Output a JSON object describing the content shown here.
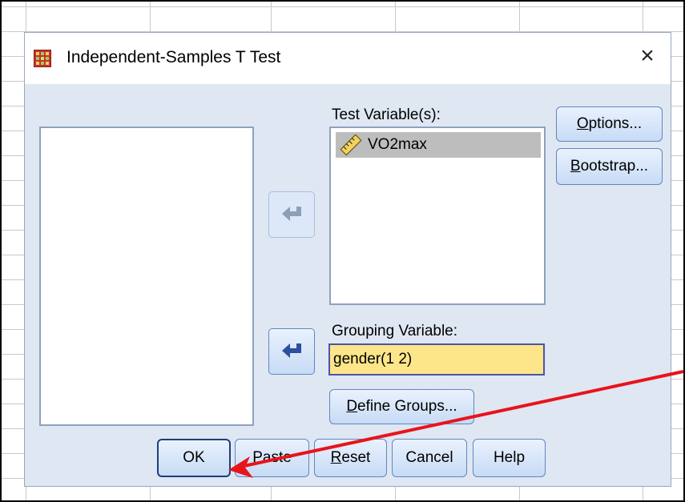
{
  "dialog": {
    "title": "Independent-Samples T Test",
    "close_symbol": "×"
  },
  "test_variables": {
    "label": "Test Variable(s):",
    "items": [
      {
        "name": "VO2max",
        "icon": "scale-ruler-icon"
      }
    ]
  },
  "grouping_variable": {
    "label": "Grouping Variable:",
    "value": "gender(1 2)"
  },
  "buttons": {
    "options": "Options...",
    "bootstrap": "Bootstrap...",
    "define_groups": "Define Groups...",
    "ok": "OK",
    "paste": "Paste",
    "reset": "Reset",
    "cancel": "Cancel",
    "help": "Help"
  },
  "colors": {
    "dialog_bg": "#dfe7f3",
    "grouping_field_bg": "#fde58a",
    "selected_row": "#bdbdbd",
    "annotation_arrow": "#e8141b"
  }
}
